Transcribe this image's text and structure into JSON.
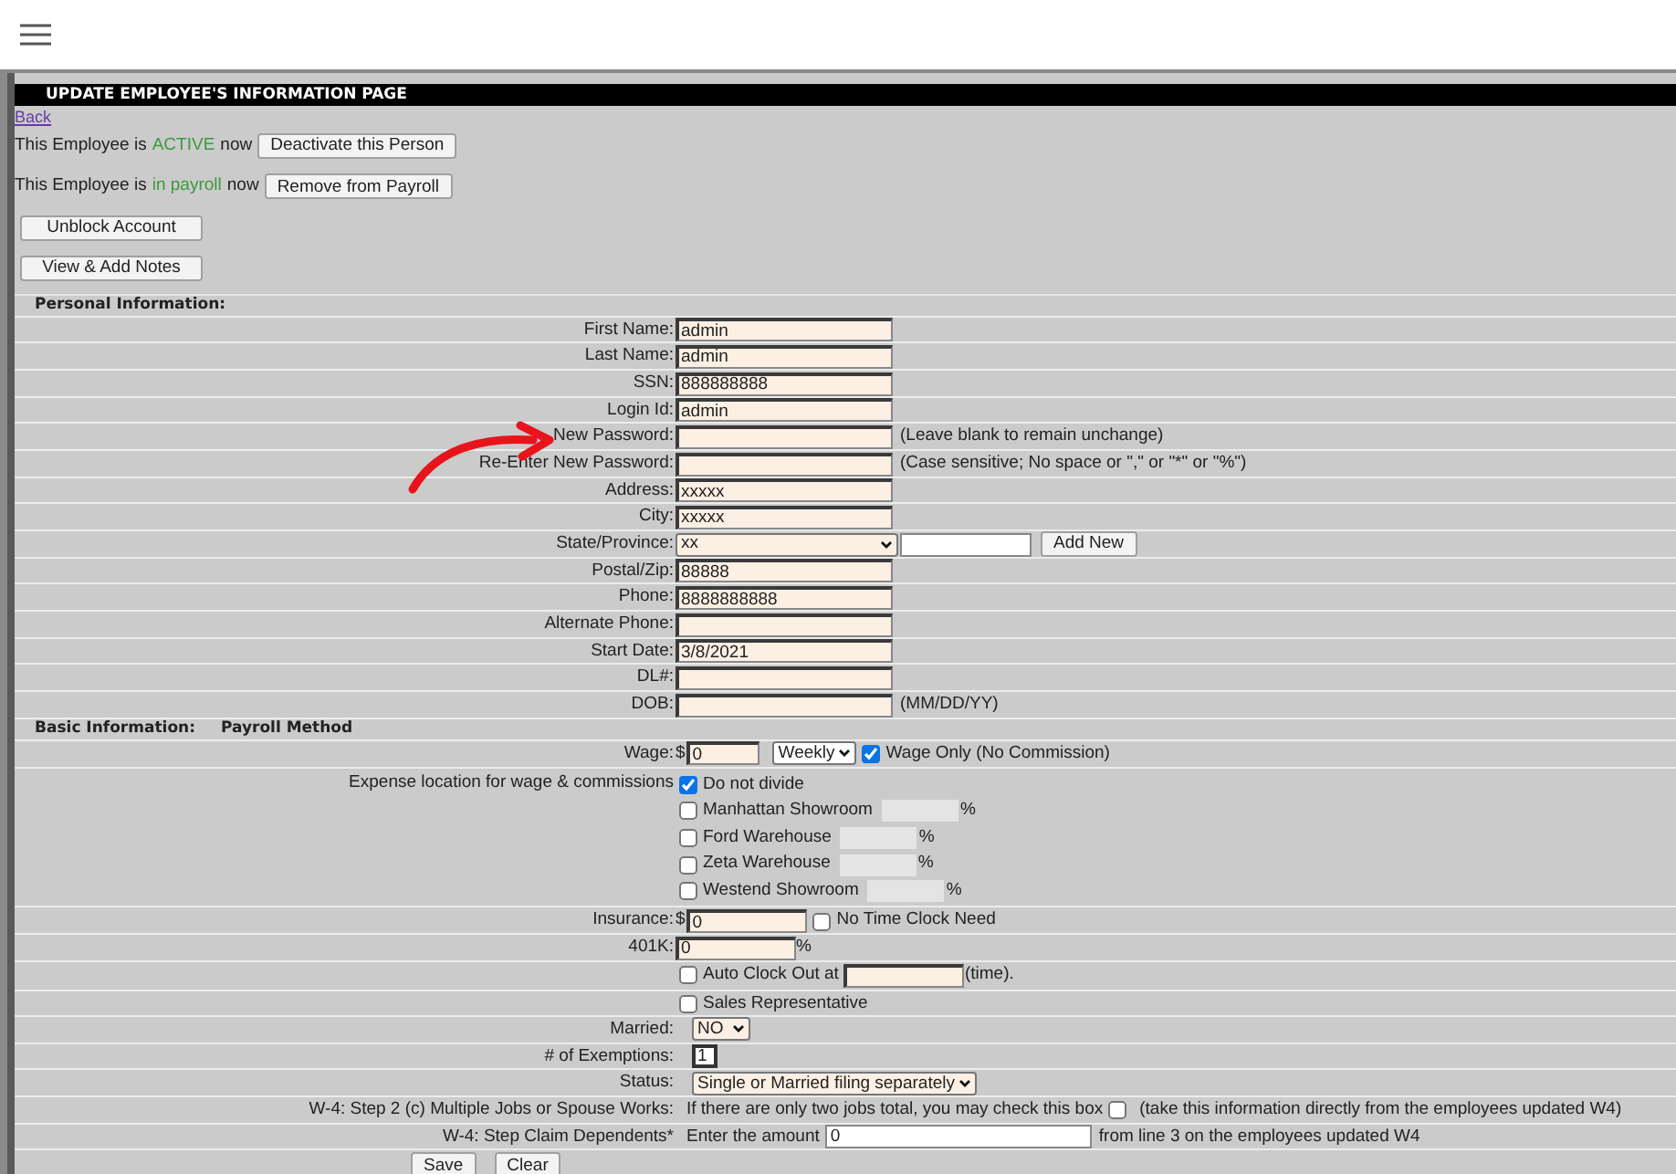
{
  "page_title": "UPDATE EMPLOYEE'S INFORMATION PAGE",
  "back_link": "Back",
  "status_lines": [
    {
      "prefix": "This Employee is",
      "status": "ACTIVE",
      "suffix": "now",
      "button": "Deactivate this Person"
    },
    {
      "prefix": "This Employee is",
      "status": "in payroll",
      "suffix": "now",
      "button": "Remove from Payroll"
    }
  ],
  "buttons": [
    "Unblock Account",
    "View & Add Notes"
  ],
  "personal": {
    "heading": "Personal Information:",
    "fields": [
      {
        "kind": "text",
        "label": "First Name:",
        "value": "admin"
      },
      {
        "kind": "text",
        "label": "Last Name:",
        "value": "admin"
      },
      {
        "kind": "text",
        "label": "SSN:",
        "value": "888888888"
      },
      {
        "kind": "text",
        "label": "Login Id:",
        "value": "admin"
      },
      {
        "kind": "text",
        "label": "New Password:",
        "note": "(Leave blank to remain unchange)"
      },
      {
        "kind": "text",
        "label": "Re-Enter New Password:",
        "note": "(Case sensitive; No space or \",\" or \"*\" or \"%\")"
      },
      {
        "kind": "text",
        "label": "Address:",
        "value": "xxxxx"
      },
      {
        "kind": "text",
        "label": "City:",
        "value": "xxxxx"
      },
      {
        "kind": "select_add",
        "label": "State/Province:",
        "value": "xx",
        "button": "Add New"
      },
      {
        "kind": "text",
        "label": "Postal/Zip:",
        "value": "88888"
      },
      {
        "kind": "text",
        "label": "Phone:",
        "value": "8888888888"
      },
      {
        "kind": "text",
        "label": "Alternate Phone:"
      },
      {
        "kind": "text",
        "label": "Start Date:",
        "value": "3/8/2021"
      },
      {
        "kind": "text",
        "label": "DL#:"
      },
      {
        "kind": "text",
        "label": "DOB:",
        "note": "(MM/DD/YY)"
      }
    ]
  },
  "basic": {
    "heading": "Basic Information:",
    "subheading": "Payroll Method",
    "rows": [
      {
        "kind": "wage",
        "label": "Wage:",
        "currency": "$",
        "value": "0",
        "period": "Weekly",
        "option": {
          "label": "Wage Only (No Commission)",
          "checked": true
        }
      },
      {
        "kind": "split",
        "label": "Expense location for wage & commissions",
        "options": [
          {
            "label": "Do not divide",
            "checked": true
          },
          {
            "label": "Manhattan Showroom",
            "checked": false,
            "unit": "%"
          },
          {
            "label": "Ford Warehouse",
            "checked": false,
            "unit": "%"
          },
          {
            "label": "Zeta Warehouse",
            "checked": false,
            "unit": "%"
          },
          {
            "label": "Westend Showroom",
            "checked": false,
            "unit": "%"
          }
        ]
      },
      {
        "kind": "money",
        "label": "Insurance:",
        "currency": "$",
        "value": "0",
        "option": {
          "label": "No Time Clock Need",
          "checked": false
        }
      },
      {
        "kind": "percent",
        "label": "401K:",
        "value": "0",
        "unit": "%"
      },
      {
        "kind": "check_field",
        "option": {
          "label": "Auto Clock Out at",
          "checked": false
        },
        "suffix": "(time)."
      },
      {
        "kind": "check",
        "option": {
          "label": "Sales Representative",
          "checked": false
        }
      },
      {
        "kind": "select",
        "label": "Married:",
        "value": "NO"
      },
      {
        "kind": "small",
        "label": "# of Exemptions:",
        "value": "1"
      },
      {
        "kind": "select",
        "label": "Status:",
        "value": "Single or Married filing separately"
      },
      {
        "kind": "w4_check",
        "label": "W-4: Step 2 (c) Multiple Jobs or Spouse Works:",
        "text": "If there are only two jobs total, you may check this box",
        "checked": false,
        "note": "(take this information directly from the employees updated W4)"
      },
      {
        "kind": "w4_amount",
        "label": "W-4: Step Claim Dependents*",
        "text": "Enter the amount",
        "value": "0",
        "note": "from line 3 on the employees updated W4"
      }
    ]
  },
  "actions": [
    "Save",
    "Clear"
  ]
}
